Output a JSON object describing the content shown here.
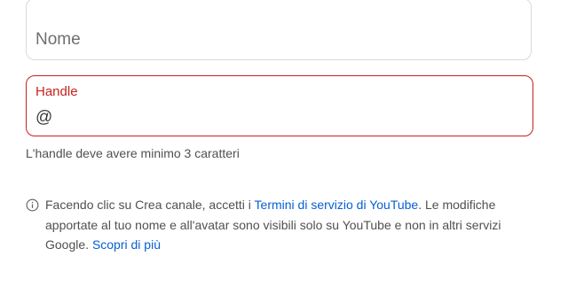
{
  "form": {
    "name_field": {
      "placeholder": "Nome",
      "value": ""
    },
    "handle_field": {
      "label": "Handle",
      "prefix": "@",
      "value": ""
    },
    "handle_error": "L'handle deve avere minimo 3 caratteri"
  },
  "disclaimer": {
    "icon": "info-icon",
    "text_before": "Facendo clic su Crea canale, accetti i ",
    "terms_link": "Termini di servizio di YouTube",
    "text_after": ". Le modifiche apportate al tuo nome e all'avatar sono visibili solo su YouTube e non in altri servizi Google. ",
    "learn_more_link": "Scopri di più"
  },
  "colors": {
    "error": "#c5221f",
    "link": "#065fd4",
    "border": "#dadada"
  }
}
